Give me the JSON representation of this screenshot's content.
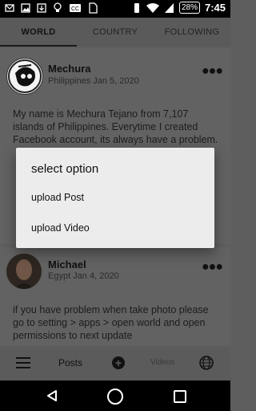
{
  "tabs": [
    "WORLD",
    "COUNTRY",
    "FOLLOWING"
  ],
  "posts": [
    {
      "name": "Mechura",
      "meta": "Philippines Jan 5, 2020",
      "body": "My name is Mechura Tejano from 7,107 islands of Philippines. Everytime  I created Facebook account, its always have a problem. Magnificent... I will"
    },
    {
      "name": "Michael",
      "meta": "Egypt Jan 4, 2020",
      "body": "if you have problem when take photo please go to setting > apps > open world and open permissions to next update"
    }
  ],
  "bottom_nav": {
    "posts": "Posts",
    "videos": "Videos"
  },
  "status_bar": {
    "battery": "28%",
    "time": "7:45"
  },
  "dialog": {
    "title": "select option",
    "options": [
      "upload Post",
      "upload Video"
    ]
  }
}
